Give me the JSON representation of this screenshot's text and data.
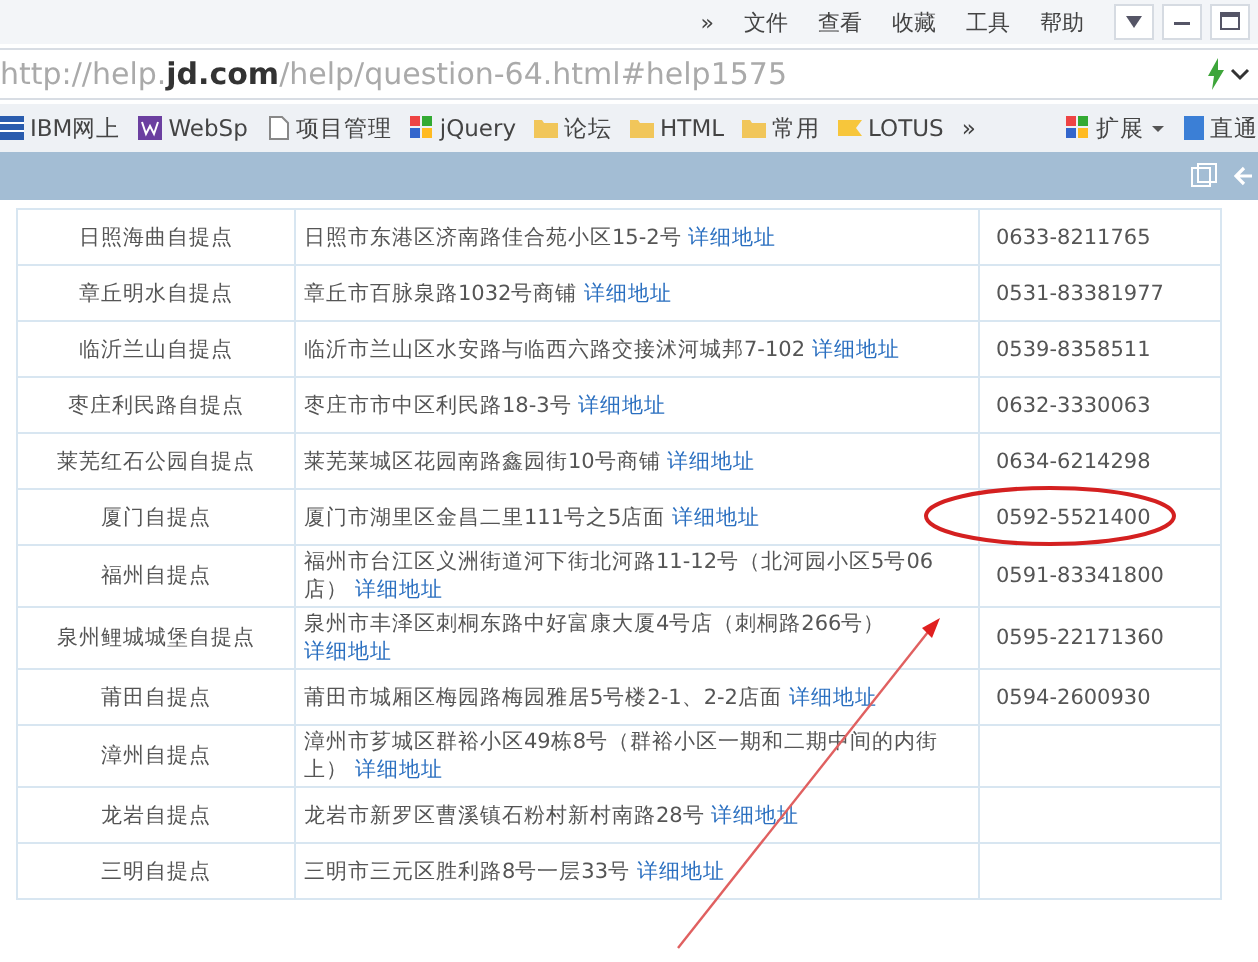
{
  "menu_bar": {
    "overflow": "»",
    "items": [
      "文件",
      "查看",
      "收藏",
      "工具",
      "帮助"
    ]
  },
  "address_bar": {
    "url": "http://help.**jd.com**/help/question-64.html#help1575"
  },
  "bookmarks": {
    "items": [
      {
        "label": "IBM网上",
        "kind": "ibm"
      },
      {
        "label": "WebSp",
        "kind": "w"
      },
      {
        "label": "项目管理",
        "kind": "page"
      },
      {
        "label": "jQuery",
        "kind": "jquery"
      },
      {
        "label": "论坛",
        "kind": "folder"
      },
      {
        "label": "HTML",
        "kind": "folder"
      },
      {
        "label": "常用",
        "kind": "folder"
      },
      {
        "label": "LOTUS",
        "kind": "lotus"
      }
    ],
    "overflow": "»",
    "extensions": "扩展",
    "right_item": "直通"
  },
  "table": {
    "rows": [
      {
        "name": "日照海曲自提点",
        "address": "日照市东港区济南路佳合苑小区15-2号",
        "link": "详细地址",
        "phone": "0633-8211765",
        "circled": false
      },
      {
        "name": "章丘明水自提点",
        "address": "章丘市百脉泉路1032号商铺",
        "link": "详细地址",
        "phone": "0531-83381977",
        "circled": false
      },
      {
        "name": "临沂兰山自提点",
        "address": "临沂市兰山区水安路与临西六路交接沭河城邦7-102",
        "link": "详细地址",
        "phone": "0539-8358511",
        "circled": false
      },
      {
        "name": "枣庄利民路自提点",
        "address": "枣庄市市中区利民路18-3号",
        "link": "详细地址",
        "phone": "0632-3330063",
        "circled": false
      },
      {
        "name": "莱芜红石公园自提点",
        "address": "莱芜莱城区花园南路鑫园街10号商铺",
        "link": "详细地址",
        "phone": "0634-6214298",
        "circled": false
      },
      {
        "name": "厦门自提点",
        "address": "厦门市湖里区金昌二里111号之5店面",
        "link": "详细地址",
        "phone": "0592-5521400",
        "circled": true
      },
      {
        "name": "福州自提点",
        "address": "福州市台江区义洲街道河下街北河路11-12号（北河园小区5号06店）",
        "link": "详细地址",
        "phone": "0591-83341800",
        "circled": false
      },
      {
        "name": "泉州鲤城城堡自提点",
        "address": "泉州市丰泽区刺桐东路中好富康大厦4号店（刺桐路266号）",
        "link": "详细地址",
        "phone": "0595-22171360",
        "circled": false
      },
      {
        "name": "莆田自提点",
        "address": "莆田市城厢区梅园路梅园雅居5号楼2-1、2-2店面",
        "link": "详细地址",
        "phone": "0594-2600930",
        "circled": false
      },
      {
        "name": "漳州自提点",
        "address": "漳州市芗城区群裕小区49栋8号（群裕小区一期和二期中间的内街上）",
        "link": "详细地址",
        "circled": false
      },
      {
        "name": "龙岩自提点",
        "address": "龙岩市新罗区曹溪镇石粉村新村南路28号",
        "link": "详细地址",
        "circled": false
      },
      {
        "name": "三明自提点",
        "address": "三明市三元区胜利路8号一层33号",
        "link": "详细地址",
        "circled": false
      }
    ]
  },
  "annotations": [
    {
      "kind": "arrow"
    }
  ]
}
